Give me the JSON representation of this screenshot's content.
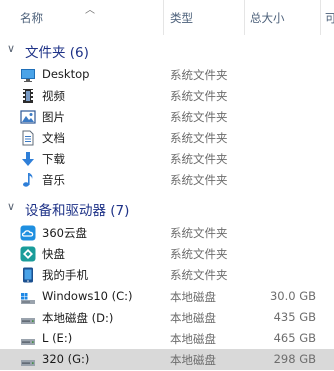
{
  "header": {
    "name": "名称",
    "type": "类型",
    "size": "总大小",
    "extra": "可"
  },
  "groups": [
    {
      "label": "文件夹 (6)"
    },
    {
      "label": "设备和驱动器 (7)"
    }
  ],
  "folders": [
    {
      "name": "Desktop",
      "type": "系统文件夹",
      "icon": "desktop-icon"
    },
    {
      "name": "视频",
      "type": "系统文件夹",
      "icon": "video-icon"
    },
    {
      "name": "图片",
      "type": "系统文件夹",
      "icon": "pictures-icon"
    },
    {
      "name": "文档",
      "type": "系统文件夹",
      "icon": "documents-icon"
    },
    {
      "name": "下载",
      "type": "系统文件夹",
      "icon": "download-icon"
    },
    {
      "name": "音乐",
      "type": "系统文件夹",
      "icon": "music-icon"
    }
  ],
  "devices": [
    {
      "name": "360云盘",
      "type": "系统文件夹",
      "size": "",
      "icon": "cloud-drive-icon"
    },
    {
      "name": "快盘",
      "type": "系统文件夹",
      "size": "",
      "icon": "kuaipan-icon"
    },
    {
      "name": "我的手机",
      "type": "系统文件夹",
      "size": "",
      "icon": "phone-icon"
    },
    {
      "name": "Windows10 (C:)",
      "type": "本地磁盘",
      "size": "30.0 GB",
      "icon": "windows-drive-icon"
    },
    {
      "name": "本地磁盘 (D:)",
      "type": "本地磁盘",
      "size": "435 GB",
      "icon": "drive-icon"
    },
    {
      "name": "L (E:)",
      "type": "本地磁盘",
      "size": "465 GB",
      "icon": "drive-icon"
    },
    {
      "name": "320 (G:)",
      "type": "本地磁盘",
      "size": "298 GB",
      "icon": "drive-icon"
    }
  ]
}
